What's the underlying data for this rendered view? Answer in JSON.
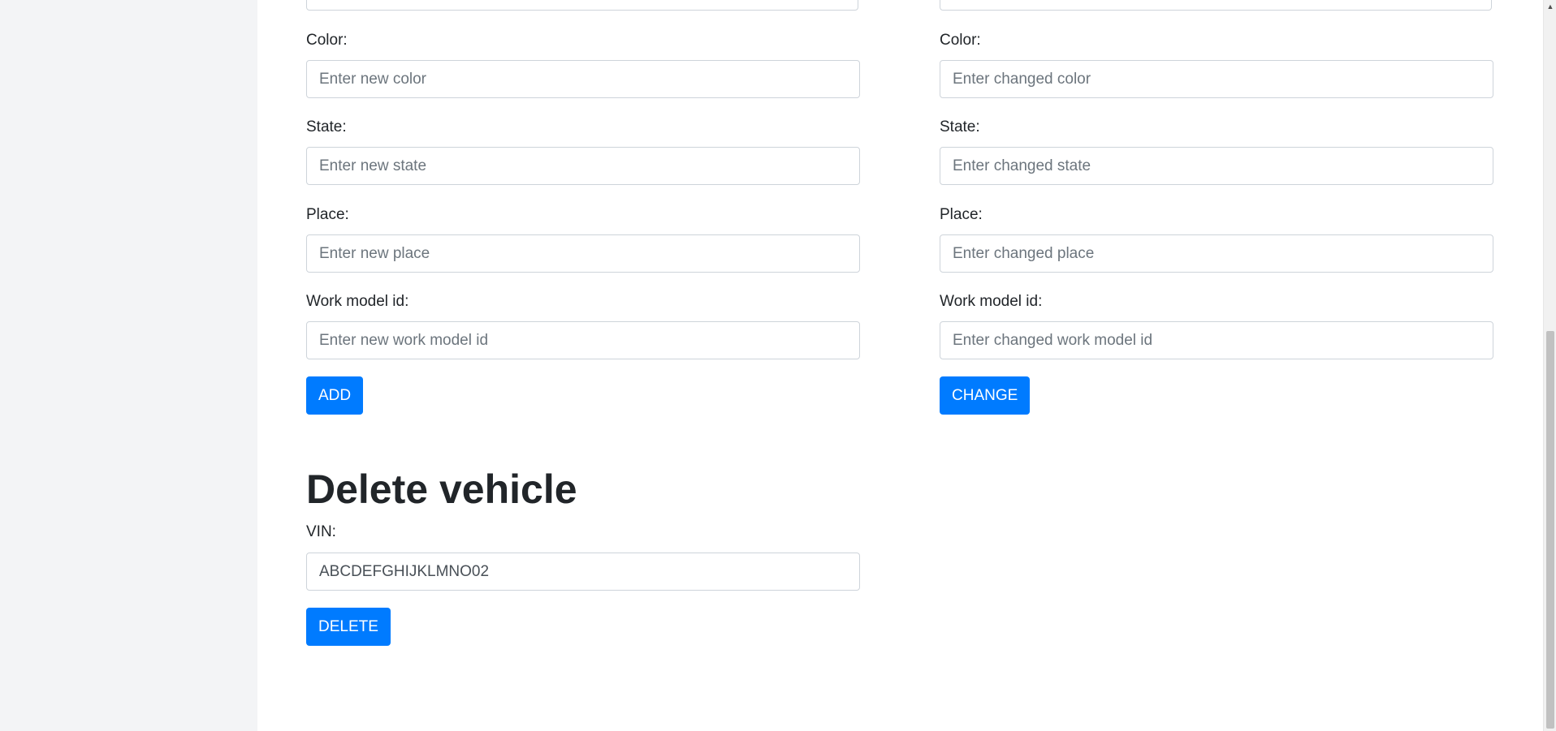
{
  "left_form": {
    "color_label": "Color:",
    "color_placeholder": "Enter new color",
    "state_label": "State:",
    "state_placeholder": "Enter new state",
    "place_label": "Place:",
    "place_placeholder": "Enter new place",
    "work_model_label": "Work model id:",
    "work_model_placeholder": "Enter new work model id",
    "submit_label": "ADD"
  },
  "right_form": {
    "color_label": "Color:",
    "color_placeholder": "Enter changed color",
    "state_label": "State:",
    "state_placeholder": "Enter changed state",
    "place_label": "Place:",
    "place_placeholder": "Enter changed place",
    "work_model_label": "Work model id:",
    "work_model_placeholder": "Enter changed work model id",
    "submit_label": "CHANGE"
  },
  "delete_section": {
    "title": "Delete vehicle",
    "vin_label": "VIN:",
    "vin_value": "ABCDEFGHIJKLMNO02",
    "submit_label": "DELETE"
  },
  "colors": {
    "primary_button": "#007bff",
    "sidebar_background": "#f3f4f6",
    "input_border": "#ced4da"
  },
  "icons": {
    "scroll_up": "scroll-up-arrow-icon"
  }
}
